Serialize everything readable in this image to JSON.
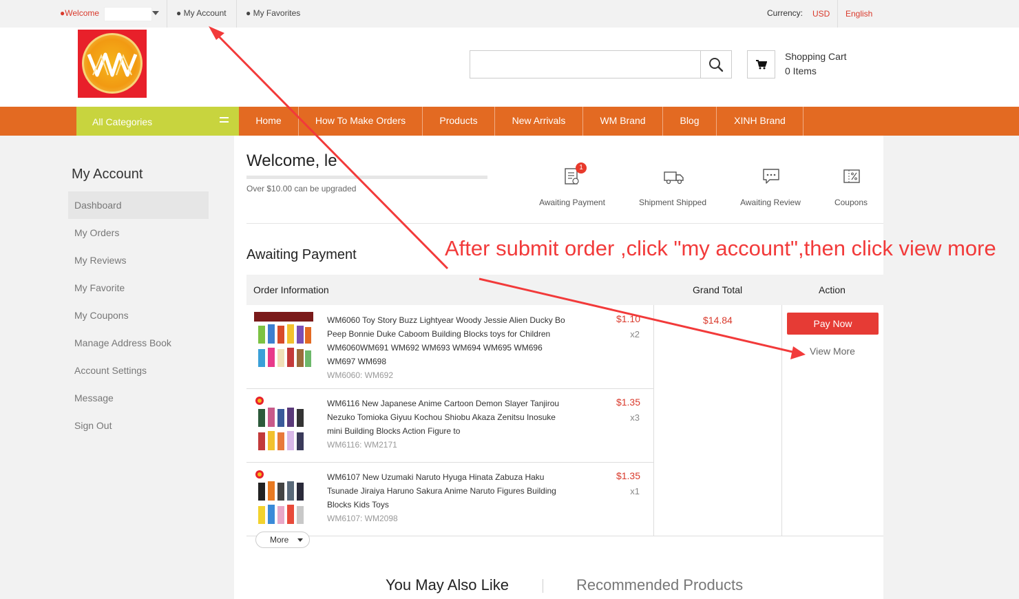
{
  "topbar": {
    "welcome": "●Welcome",
    "my_account": "●  My Account",
    "my_favorites": "●  My Favorites",
    "currency_label": "Currency:",
    "currency_value": "USD",
    "language": "English"
  },
  "header": {
    "search_placeholder": "",
    "cart_title": "Shopping Cart",
    "cart_items": "0 Items"
  },
  "nav": {
    "all_categories": "All Categories",
    "items": [
      "Home",
      "How To Make Orders",
      "Products",
      "New Arrivals",
      "WM Brand",
      "Blog",
      "XINH Brand"
    ]
  },
  "sidebar": {
    "title": "My Account",
    "items": [
      "Dashboard",
      "My Orders",
      "My Reviews",
      "My Favorite",
      "My Coupons",
      "Manage Address Book",
      "Account Settings",
      "Message",
      "Sign Out"
    ]
  },
  "account": {
    "welcome": "Welcome,    le",
    "upgrade_note": "Over $10.00 can be upgraded",
    "statuses": [
      {
        "label": "Awaiting Payment",
        "icon": "order-list-icon",
        "badge": "1"
      },
      {
        "label": "Shipment Shipped",
        "icon": "truck-icon"
      },
      {
        "label": "Awaiting Review",
        "icon": "chat-bubble-icon"
      },
      {
        "label": "Coupons",
        "icon": "coupon-icon"
      }
    ]
  },
  "orders": {
    "section_title": "Awaiting Payment",
    "headers": {
      "info": "Order Information",
      "total": "Grand Total",
      "action": "Action"
    },
    "products": [
      {
        "name": "WM6060 Toy Story Buzz Lightyear Woody Jessie Alien Ducky Bo Peep Bonnie Duke Caboom Building Blocks toys for Children WM6060WM691 WM692 WM693 WM694 WM695 WM696 WM697 WM698",
        "sku": "WM6060: WM692",
        "price": "$1.10",
        "qty": "x2"
      },
      {
        "name": "WM6116 New Japanese Anime Cartoon Demon Slayer Tanjirou Nezuko Tomioka Giyuu Kochou Shiobu Akaza Zenitsu Inosuke mini Building Blocks Action Figure to",
        "sku": "WM6116: WM2171",
        "price": "$1.35",
        "qty": "x3"
      },
      {
        "name": "WM6107 New Uzumaki Naruto Hyuga Hinata Zabuza Haku Tsunade Jiraiya Haruno Sakura Anime Naruto Figures Building Blocks Kids Toys",
        "sku": "WM6107: WM2098",
        "price": "$1.35",
        "qty": "x1"
      }
    ],
    "grand_total": "$14.84",
    "pay_now": "Pay Now",
    "view_more": "View More",
    "more": "More"
  },
  "footer_tabs": {
    "also_like": "You May Also Like",
    "recommended": "Recommended Products"
  },
  "annotation": "After submit order ,click \"my account\",then click view more",
  "colors": {
    "accent": "#e36a22",
    "category": "#c8d43e",
    "price": "#d9392b",
    "button": "#e63b35",
    "annotation": "#f23a3a"
  }
}
